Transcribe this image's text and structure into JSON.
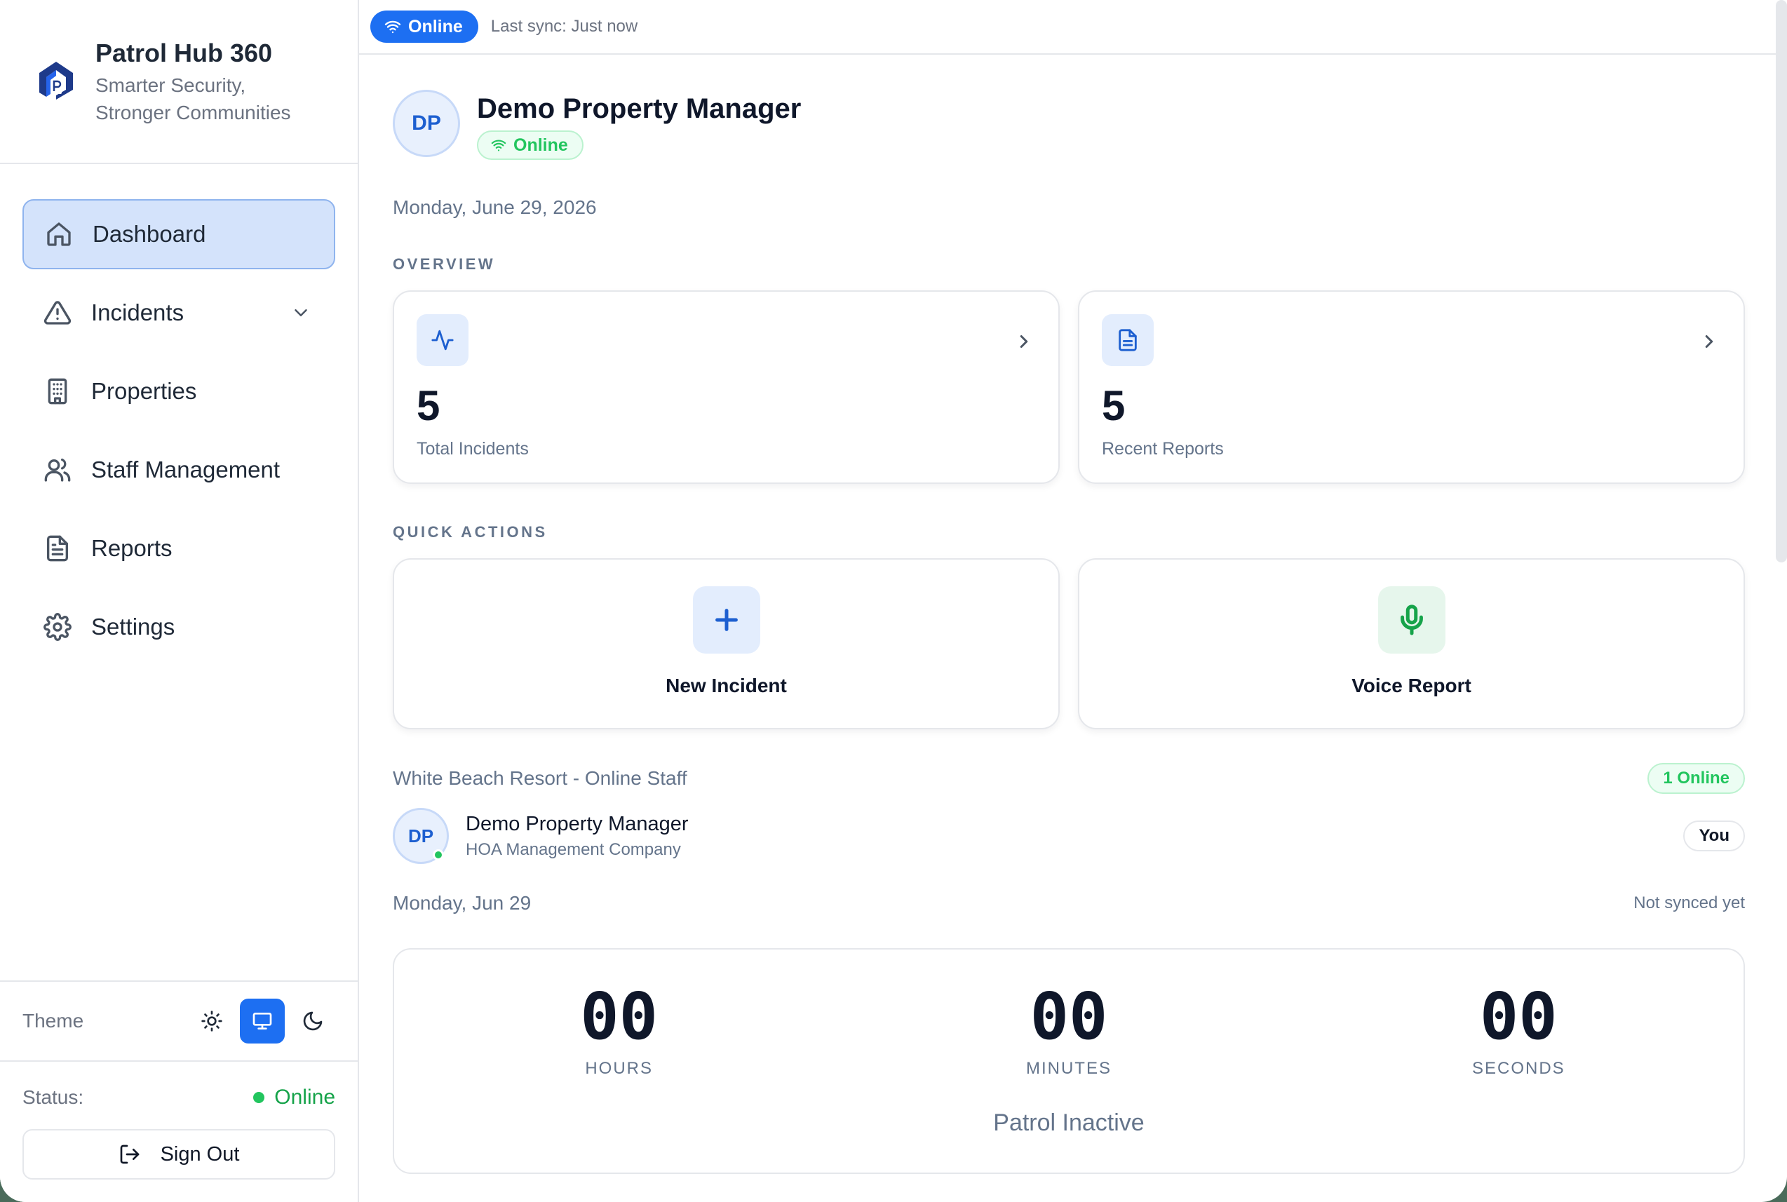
{
  "brand": {
    "title": "Patrol Hub 360",
    "tagline_line1": "Smarter Security,",
    "tagline_line2": "Stronger Communities"
  },
  "sidebar": {
    "items": [
      {
        "label": "Dashboard",
        "icon": "home-icon",
        "active": true
      },
      {
        "label": "Incidents",
        "icon": "alert-triangle-icon",
        "has_submenu": true
      },
      {
        "label": "Properties",
        "icon": "building-icon"
      },
      {
        "label": "Staff Management",
        "icon": "users-icon"
      },
      {
        "label": "Reports",
        "icon": "file-text-icon"
      },
      {
        "label": "Settings",
        "icon": "gear-icon"
      }
    ],
    "theme_label": "Theme",
    "theme_options": [
      "light",
      "system",
      "dark"
    ],
    "theme_selected": "system",
    "status_label": "Status:",
    "status_value": "Online",
    "signout_label": "Sign Out"
  },
  "topbar": {
    "online_label": "Online",
    "sync_text": "Last sync: Just now"
  },
  "profile": {
    "initials": "DP",
    "name": "Demo Property Manager",
    "status": "Online"
  },
  "date": "Monday, June 29, 2026",
  "overview": {
    "label": "OVERVIEW",
    "cards": [
      {
        "value": "5",
        "label": "Total Incidents",
        "icon": "activity-icon"
      },
      {
        "value": "5",
        "label": "Recent Reports",
        "icon": "file-text-icon"
      }
    ]
  },
  "quick_actions": {
    "label": "QUICK ACTIONS",
    "items": [
      {
        "label": "New Incident",
        "icon": "plus-icon"
      },
      {
        "label": "Voice Report",
        "icon": "microphone-icon"
      }
    ]
  },
  "staff": {
    "title": "White Beach Resort - Online Staff",
    "count_label": "1 Online",
    "members": [
      {
        "initials": "DP",
        "name": "Demo Property Manager",
        "org": "HOA Management Company",
        "tag": "You"
      }
    ]
  },
  "patrol": {
    "date": "Monday, Jun 29",
    "sync_status": "Not synced yet",
    "hours": "00",
    "minutes": "00",
    "seconds": "00",
    "hours_label": "HOURS",
    "minutes_label": "MINUTES",
    "seconds_label": "SECONDS",
    "status": "Patrol Inactive"
  },
  "colors": {
    "accent": "#1d6ff2",
    "online_green": "#22c55e",
    "active_nav_bg": "#d4e3fb"
  }
}
